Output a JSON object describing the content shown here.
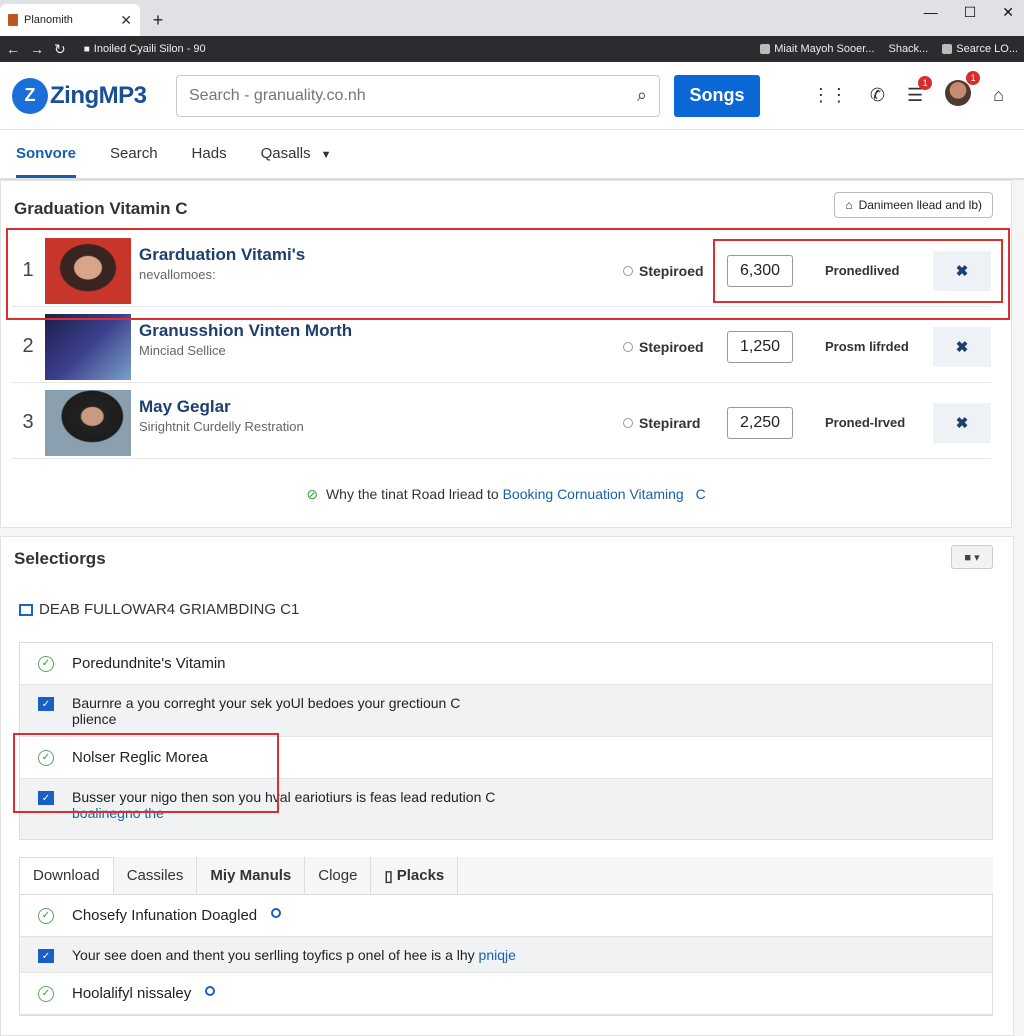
{
  "browser": {
    "tab_title": "Planomith",
    "url": "Inoiled Cyaili Silon - 90",
    "bookmarks": [
      "Miait Mayoh Sooer...",
      "Shack...",
      "Searce LO..."
    ]
  },
  "header": {
    "logo": "ZingMP3",
    "search_placeholder": "Search - granuality.co.nh",
    "songs_button": "Songs",
    "badge_1": "1",
    "badge_2": "1"
  },
  "nav": {
    "tabs": [
      "Sonvore",
      "Search",
      "Hads",
      "Qasalls"
    ]
  },
  "chart_list": {
    "title": "Graduation Vitamin C",
    "action": "Danimeen llead and lb)",
    "rows": [
      {
        "rank": "1",
        "title": "Grarduation Vitami's",
        "sub": "nevallomoes:",
        "status": "Stepiroed",
        "count": "6,300",
        "label": "Pronedlived"
      },
      {
        "rank": "2",
        "title": "Granusshion Vinten Morth",
        "sub": "Minciad Sellice",
        "status": "Stepiroed",
        "count": "1,250",
        "label": "Prosm lifrded"
      },
      {
        "rank": "3",
        "title": "May Geglar",
        "sub": "Sirightnit Curdelly Restration",
        "status": "Stepirard",
        "count": "2,250",
        "label": "Proned-lrved"
      }
    ],
    "footer_text": "Why the tinat Road lriead to",
    "footer_link": "Booking Cornuation Vitaming"
  },
  "selections": {
    "title": "Selectiorgs",
    "section_heading": "DEAB FULLOWAR4 GRIAMBDING C1",
    "faq": [
      {
        "q": "Poredundnite's Vitamin",
        "a": "Baurnre a you correght your sek yoUl bedoes your grectioun C plience",
        "a_link": ""
      },
      {
        "q": "Nolser Reglic Morea",
        "a": "Busser your nigo then son you hval eariotiurs is feas lead redution C",
        "a_link": "boalinegno the"
      }
    ],
    "tabs": [
      "Download",
      "Cassiles",
      "Miy Manuls",
      "Cloge",
      "Placks"
    ],
    "tab_faq": [
      {
        "q": "Chosefy Infunation Doagled",
        "a": "Your see doen and thent you serlling toyfics p onel of hee is a lhy",
        "a_link": "pniqje"
      },
      {
        "q": "Hoolalifyl nissaley",
        "a": "",
        "a_link": ""
      }
    ]
  }
}
